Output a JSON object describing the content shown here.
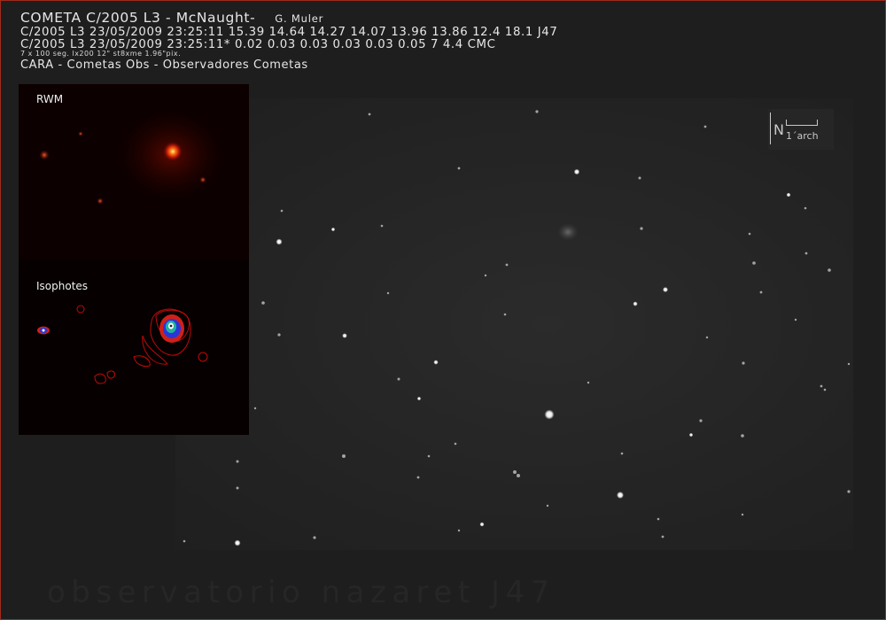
{
  "header": {
    "title": "COMETA C/2005 L3 - McNaught-",
    "author": "G. Muler",
    "line2": "C/2005 L3 23/05/2009 23:25:11 15.39 14.64 14.27 14.07 13.96 13.86 12.4 18.1 J47",
    "line3": "C/2005 L3 23/05/2009 23:25:11* 0.02 0.03 0.03 0.03 0.03 0.05 7 4.4 CMC",
    "line4": "7 x 100 seg. lx200 12\" st8xme 1.96\"pix.",
    "line5": "CARA - Cometas Obs - Observadores Cometas"
  },
  "scale_indicator": {
    "north": "N",
    "label": "1´arch"
  },
  "inset": {
    "top_label": "RWM",
    "bottom_label": "Isophotes"
  },
  "footer": "observatorio nazaret J47",
  "colors": {
    "background": "#1e1e1e",
    "border": "#a02a1c",
    "text": "#e6e6e6"
  }
}
